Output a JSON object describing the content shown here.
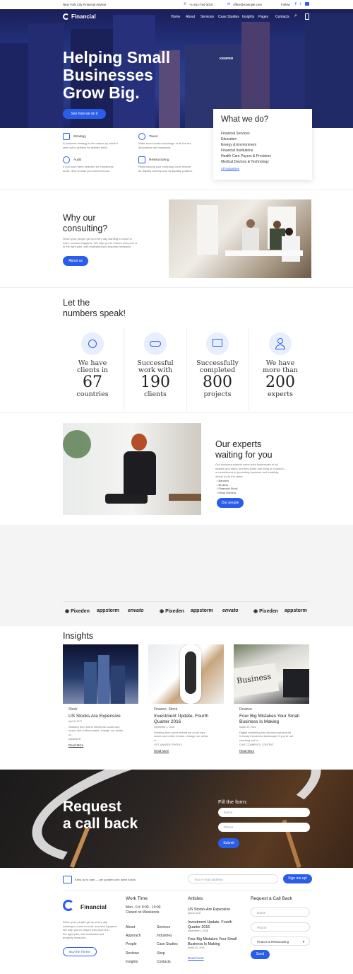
{
  "topbar": {
    "tagline": "New York City Financial Advisor",
    "phone": "+1 541-784-3010",
    "email": "office@example.com",
    "follow": "Follow"
  },
  "brand": {
    "name": "Financial"
  },
  "nav": [
    "Home",
    "About",
    "Services",
    "Case Studies",
    "Insights",
    "Pages",
    "Contacts"
  ],
  "hero": {
    "line1": "Helping Small",
    "line2": "Businesses",
    "line3": "Grow Big.",
    "cta": "See how we do it",
    "building_sign": "KEMPER"
  },
  "services": [
    {
      "title": "Strategy",
      "text1": "A business strategy is the means by which it",
      "text2": "sets out to achieve its desired ends."
    },
    {
      "title": "Taxes",
      "text1": "Make sure to take advantage of all the tax",
      "text2": "deductions and expenses."
    },
    {
      "title": "Audit",
      "text1": "If you have been selected for a business",
      "text2": "audit. Here is what you need to know."
    },
    {
      "title": "Restructuring",
      "text1": "Restructuring your company could restore",
      "text2": "its viability and improve its liquidity position."
    }
  ],
  "what_we_do": {
    "title": "What we do?",
    "items": [
      "Financial Services",
      "Education",
      "Energy & Environment",
      "Financial Institutions",
      "Health Care Payers & Providers",
      "Medical Devices & Technology"
    ],
    "link": "All industries"
  },
  "consulting": {
    "title1": "Why our",
    "title2": "consulting?",
    "text1": "When your people get up every day wanting to come to",
    "text2": "work, success happens. We help you to ensure everyone is",
    "text3": "in the right jobs, well motivated and properly rewarded.",
    "button": "About us"
  },
  "numbers": {
    "title1": "Let the",
    "title2": "numbers speak!",
    "stats": [
      {
        "l1": "We have",
        "l2": "clients in",
        "num": "67",
        "unit": "countries"
      },
      {
        "l1": "Successful",
        "l2": "work with",
        "num": "190",
        "unit": "clients"
      },
      {
        "l1": "Successfully",
        "l2": "completed",
        "num": "800",
        "unit": "projects"
      },
      {
        "l1": "We have",
        "l2": "more than",
        "num": "200",
        "unit": "experts"
      }
    ]
  },
  "experts": {
    "title1": "Our experts",
    "title2": "waiting for you",
    "text1": "Our business experts come from businesses of all",
    "text2": "shapes and sizes, but they share one thing in common –",
    "text3": "a commitment to promoting business and enabling",
    "text4": "others to do the same.",
    "list": [
      "Bankers",
      "Brokers",
      "Financial Stock",
      "Head Hunters"
    ],
    "button": "Our people"
  },
  "logos": [
    "Pixeden",
    "appstorm",
    "envato",
    "Pixeden",
    "appstorm",
    "envato",
    "Pixeden",
    "appstorm"
  ],
  "insights": {
    "title": "Insights",
    "posts": [
      {
        "cat": "Stock",
        "t1": "US Stocks Are Expensive",
        "t2": "",
        "date": "April 5, 2017",
        "x1": "Working from home meant we could vary",
        "x2": "snack and coffee breaks, change our desks",
        "x3": "or...",
        "tags": "MANAGER",
        "read": "Read More"
      },
      {
        "cat": "Finance, Stock",
        "t1": "Investment Update, Fourth",
        "t2": "Quarter 2016",
        "date": "September 1, 2016",
        "x1": "Working from home meant we could vary",
        "x2": "snack and coffee breaks, change our desks",
        "x3": "or...",
        "tags": "GIFT, AWARDS, PROFILE",
        "read": "Read More"
      },
      {
        "cat": "Finance",
        "t1": "Four Big Mistakes Your Small",
        "t2": "Business Is Making",
        "date": "March 20, 2016",
        "x1": "Digital marketing has become paramount",
        "x2": "in today's business landscape. If you're not",
        "x3": "reaching out to...",
        "tags": "CHAT, COMMENTS, CONTENT",
        "read": "Read More"
      }
    ]
  },
  "callback": {
    "title1": "Request",
    "title2": "a call back",
    "form_title": "Fill the form:",
    "name_ph": "Name",
    "phone_ph": "Phone",
    "submit": "Submit"
  },
  "newsletter": {
    "text": "Keep up to date — get updates with latest topics.",
    "placeholder": "Your e-mail address",
    "button": "Sign me up!"
  },
  "footer": {
    "brand_text1": "When your people get up every day",
    "brand_text2": "wanting to come to work, success happens.",
    "brand_text3": "We help you to ensure everyone is in",
    "brand_text4": "the right jobs, well motivated and",
    "brand_text5": "properly rewarded.",
    "buy": "Buy the Theme",
    "work_title": "Work Time",
    "work1": "Mon - Fri: 9:00 - 19:00",
    "work2": "Closed on Weekends",
    "links_a": [
      "About",
      "Approach",
      "People",
      "Reviews",
      "Insights"
    ],
    "links_b": [
      "Services",
      "Industries",
      "Case Studies",
      "Shop",
      "Contacts"
    ],
    "articles_title": "Articles",
    "articles": [
      {
        "t1": "US Stocks Are Expensive",
        "t2": "",
        "date": "April 5, 2017"
      },
      {
        "t1": "Investment Update, Fourth",
        "t2": "Quarter 2016",
        "date": "September 1, 2016"
      },
      {
        "t1": "Four Big Mistakes Your Small",
        "t2": "Business Is Making",
        "date": "March 20, 2016"
      }
    ],
    "articles_more": "Read more",
    "cb_title": "Request a Call Back",
    "cb_name": "Name",
    "cb_phone": "Phone",
    "cb_select": "Finance & Restructuring",
    "cb_send": "Send"
  },
  "colors": {
    "accent": "#2a5ee8",
    "hero_dark": "#1b1f5a"
  }
}
